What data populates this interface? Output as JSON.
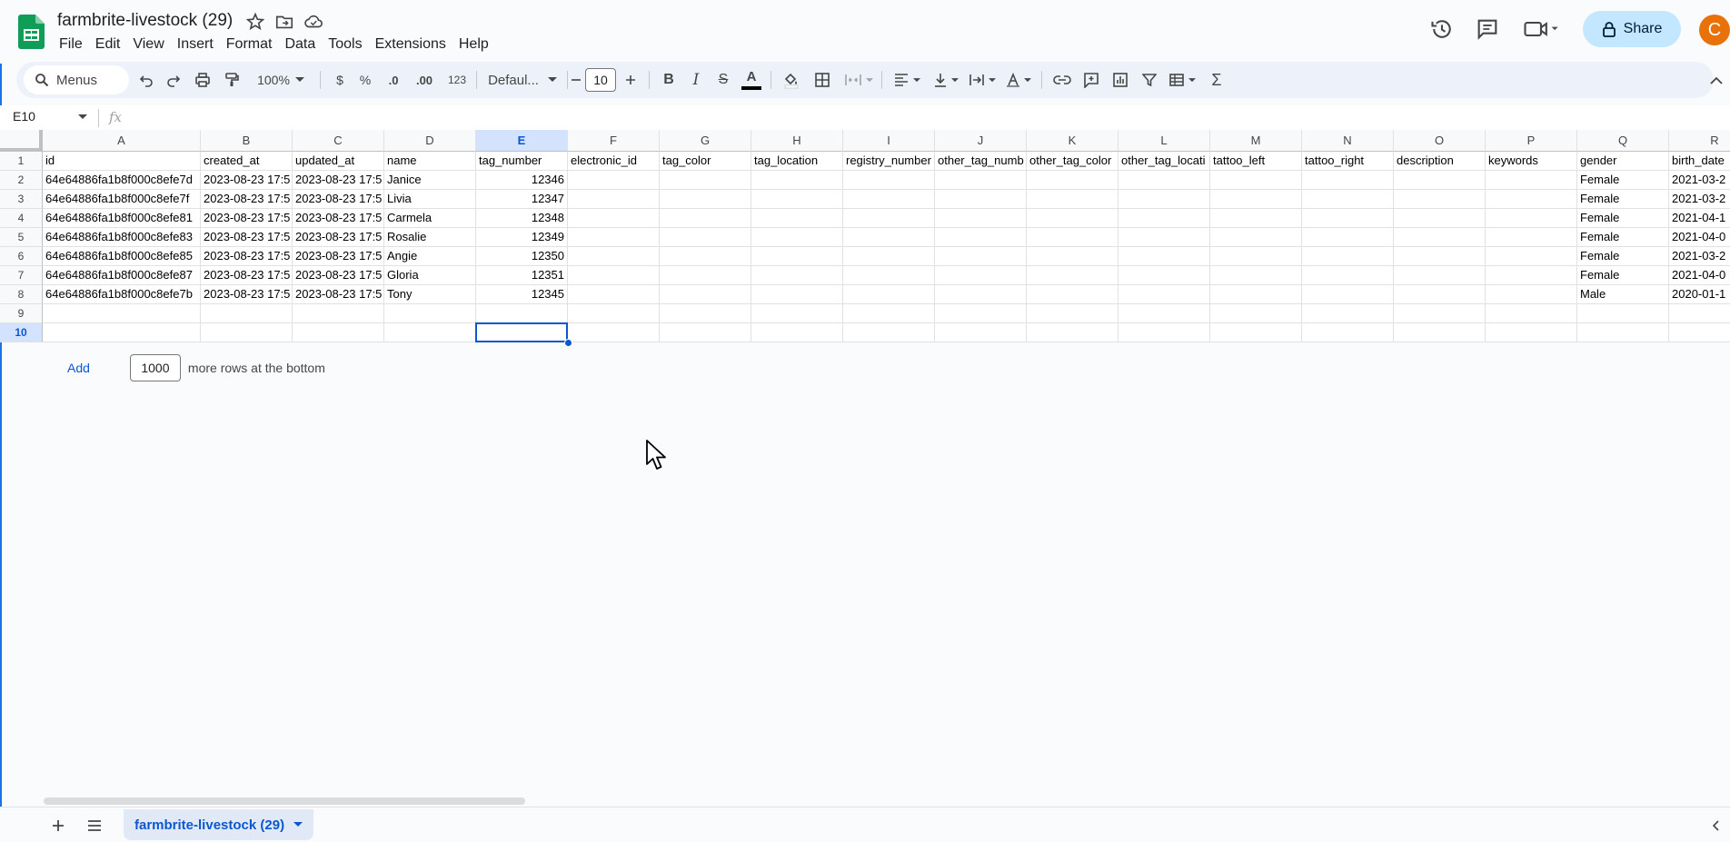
{
  "app": {
    "doc_title": "farmbrite-livestock (29)",
    "menu": [
      "File",
      "Edit",
      "View",
      "Insert",
      "Format",
      "Data",
      "Tools",
      "Extensions",
      "Help"
    ],
    "share_label": "Share",
    "avatar_letter": "C"
  },
  "toolbar": {
    "menus_label": "Menus",
    "zoom": "100%",
    "currency": "$",
    "percent": "%",
    "dec_decrease": ".0",
    "dec_increase": ".00",
    "number_format": "123",
    "font_family": "Defaul...",
    "font_size": "10",
    "bold": "B",
    "italic": "I",
    "strike": "S",
    "text_color_label": "A",
    "function_symbol": "Σ"
  },
  "formula_bar": {
    "name_box": "E10",
    "fx": "fx",
    "value": ""
  },
  "sheet": {
    "columns": [
      "A",
      "B",
      "C",
      "D",
      "E",
      "F",
      "G",
      "H",
      "I",
      "J",
      "K",
      "L",
      "M",
      "N",
      "O",
      "P",
      "Q",
      "R"
    ],
    "rows": [
      "1",
      "2",
      "3",
      "4",
      "5",
      "6",
      "7",
      "8",
      "9",
      "10"
    ],
    "selected_col": "E",
    "selected_row": "10",
    "data": [
      [
        "id",
        "created_at",
        "updated_at",
        "name",
        "tag_number",
        "electronic_id",
        "tag_color",
        "tag_location",
        "registry_number",
        "other_tag_numb",
        "other_tag_color",
        "other_tag_locati",
        "tattoo_left",
        "tattoo_right",
        "description",
        "keywords",
        "gender",
        "birth_date"
      ],
      [
        "64e64886fa1b8f000c8efe7d",
        "2023-08-23 17:5",
        "2023-08-23 17:5",
        "Janice",
        "12346",
        "",
        "",
        "",
        "",
        "",
        "",
        "",
        "",
        "",
        "",
        "",
        "Female",
        "2021-03-2"
      ],
      [
        "64e64886fa1b8f000c8efe7f",
        "2023-08-23 17:5",
        "2023-08-23 17:5",
        "Livia",
        "12347",
        "",
        "",
        "",
        "",
        "",
        "",
        "",
        "",
        "",
        "",
        "",
        "Female",
        "2021-03-2"
      ],
      [
        "64e64886fa1b8f000c8efe81",
        "2023-08-23 17:5",
        "2023-08-23 17:5",
        "Carmela",
        "12348",
        "",
        "",
        "",
        "",
        "",
        "",
        "",
        "",
        "",
        "",
        "",
        "Female",
        "2021-04-1"
      ],
      [
        "64e64886fa1b8f000c8efe83",
        "2023-08-23 17:5",
        "2023-08-23 17:5",
        "Rosalie",
        "12349",
        "",
        "",
        "",
        "",
        "",
        "",
        "",
        "",
        "",
        "",
        "",
        "Female",
        "2021-04-0"
      ],
      [
        "64e64886fa1b8f000c8efe85",
        "2023-08-23 17:5",
        "2023-08-23 17:5",
        "Angie",
        "12350",
        "",
        "",
        "",
        "",
        "",
        "",
        "",
        "",
        "",
        "",
        "",
        "Female",
        "2021-03-2"
      ],
      [
        "64e64886fa1b8f000c8efe87",
        "2023-08-23 17:5",
        "2023-08-23 17:5",
        "Gloria",
        "12351",
        "",
        "",
        "",
        "",
        "",
        "",
        "",
        "",
        "",
        "",
        "",
        "Female",
        "2021-04-0"
      ],
      [
        "64e64886fa1b8f000c8efe7b",
        "2023-08-23 17:5",
        "2023-08-23 17:5",
        "Tony",
        "12345",
        "",
        "",
        "",
        "",
        "",
        "",
        "",
        "",
        "",
        "",
        "",
        "Male",
        "2020-01-1"
      ],
      [
        "",
        "",
        "",
        "",
        "",
        "",
        "",
        "",
        "",
        "",
        "",
        "",
        "",
        "",
        "",
        "",
        "",
        ""
      ],
      [
        "",
        "",
        "",
        "",
        "",
        "",
        "",
        "",
        "",
        "",
        "",
        "",
        "",
        "",
        "",
        "",
        "",
        ""
      ]
    ],
    "numeric_columns": [
      4
    ]
  },
  "add_rows": {
    "link": "Add",
    "count": "1000",
    "suffix": "more rows at the bottom"
  },
  "tabs": {
    "active": "farmbrite-livestock (29)"
  },
  "colors": {
    "accent": "#0b57d0",
    "share_bg": "#c2e7ff",
    "avatar_bg": "#e8710a",
    "sheets_green": "#0f9d58"
  }
}
